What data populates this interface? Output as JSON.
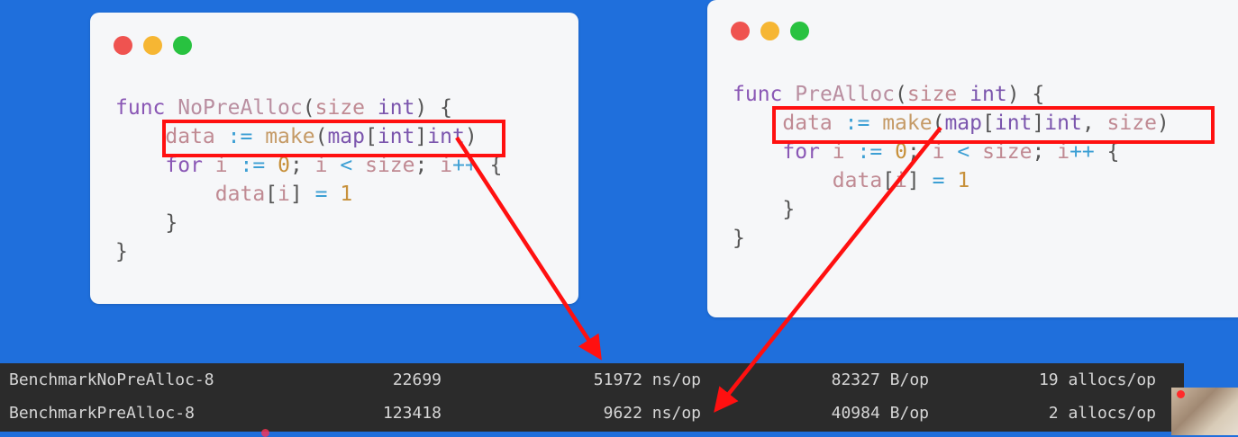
{
  "left_card": {
    "lines": {
      "l1": {
        "func": "func",
        "name": "NoPreAlloc",
        "open": "(",
        "param": "size",
        "type": "int",
        "close": ") {"
      },
      "l2": {
        "ident": "data",
        "op": ":=",
        "make": "make",
        "p1": "(",
        "map": "map",
        "b1": "[",
        "key": "int",
        "b2": "]",
        "val": "int",
        "p2": ")"
      },
      "l3": {
        "kw": "for",
        "i": "i",
        "assign": ":=",
        "zero": "0",
        "semi1": ";",
        "i2": "i",
        "lt": "<",
        "size": "size",
        "semi2": ";",
        "i3": "i",
        "inc": "++",
        "brace": "{"
      },
      "l4": {
        "data": "data",
        "b1": "[",
        "i": "i",
        "b2": "]",
        "eq": "=",
        "one": "1"
      },
      "l5": {
        "brace": "}"
      },
      "l6": {
        "brace": "}"
      }
    }
  },
  "right_card": {
    "lines": {
      "l1": {
        "func": "func",
        "name": "PreAlloc",
        "open": "(",
        "param": "size",
        "type": "int",
        "close": ") {"
      },
      "l2": {
        "ident": "data",
        "op": ":=",
        "make": "make",
        "p1": "(",
        "map": "map",
        "b1": "[",
        "key": "int",
        "b2": "]",
        "val": "int",
        "comma": ",",
        "size": "size",
        "p2": ")"
      },
      "l3": {
        "kw": "for",
        "i": "i",
        "assign": ":=",
        "zero": "0",
        "semi1": ";",
        "i2": "i",
        "lt": "<",
        "size": "size",
        "semi2": ";",
        "i3": "i",
        "inc": "++",
        "brace": "{"
      },
      "l4": {
        "data": "data",
        "b1": "[",
        "i": "i",
        "b2": "]",
        "eq": "=",
        "one": "1"
      },
      "l5": {
        "brace": "}"
      },
      "l6": {
        "brace": "}"
      }
    }
  },
  "benchmarks": [
    {
      "name": "BenchmarkNoPreAlloc-8",
      "iterations": "22699",
      "ns_per_op": "51972 ns/op",
      "bytes_per_op": "82327 B/op",
      "allocs_per_op": "19 allocs/op"
    },
    {
      "name": "BenchmarkPreAlloc-8",
      "iterations": "123418",
      "ns_per_op": "9622 ns/op",
      "bytes_per_op": "40984 B/op",
      "allocs_per_op": "2 allocs/op"
    }
  ],
  "colors": {
    "background": "#1f6fdc",
    "highlight": "#ff1010",
    "terminal_bg": "#2b2b2b"
  },
  "icons": {
    "window_controls": [
      "close-dot",
      "minimize-dot",
      "maximize-dot"
    ],
    "arrows": [
      "arrow-left-to-nopre",
      "arrow-right-to-pre"
    ]
  }
}
